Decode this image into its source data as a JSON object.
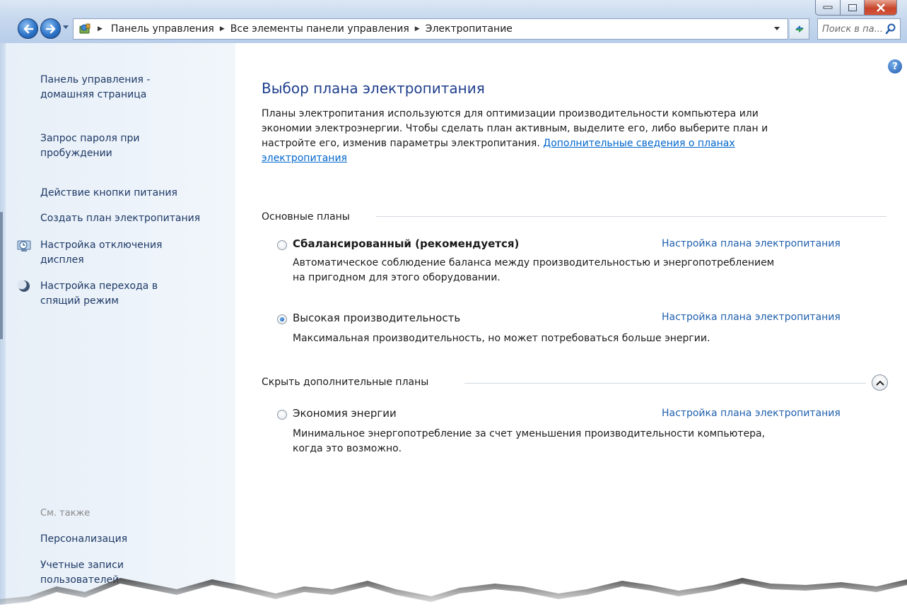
{
  "address": {
    "crumbs": [
      "Панель управления",
      "Все элементы панели управления",
      "Электропитание"
    ],
    "search_placeholder": "Поиск в па..."
  },
  "sidebar": {
    "home_line1": "Панель управления -",
    "home_line2": "домашняя страница",
    "items": [
      {
        "line1": "Запрос пароля при",
        "line2": "пробуждении"
      },
      {
        "line1": "Действие кнопки питания"
      },
      {
        "line1": "Создать план электропитания"
      },
      {
        "line1": "Настройка отключения",
        "line2": "дисплея",
        "icon": "display-clock-icon"
      },
      {
        "line1": "Настройка перехода в",
        "line2": "спящий режим",
        "icon": "sleep-moon-icon"
      }
    ],
    "see_also_label": "См. также",
    "see_also": [
      {
        "line1": "Персонализация"
      },
      {
        "line1": "Учетные записи",
        "line2": "пользователей"
      }
    ]
  },
  "main": {
    "title": "Выбор плана электропитания",
    "desc_line1": "Планы электропитания используются для оптимизации производительности компьютера или",
    "desc_line2": "экономии электроэнергии. Чтобы сделать план активным, выделите его, либо выберите план и",
    "desc_line3": "настройте его, изменив параметры электропитания.",
    "desc_link_part1": "Дополнительные сведения о планах",
    "desc_link_part2": "электропитания",
    "section_basic": "Основные планы",
    "section_hide": "Скрыть дополнительные планы",
    "plans": [
      {
        "name": "Сбалансированный (рекомендуется)",
        "selected": false,
        "link": "Настройка плана электропитания",
        "desc_line1": "Автоматическое соблюдение баланса между производительностью и энергопотреблением",
        "desc_line2": "на пригодном для этого оборудовании."
      },
      {
        "name": "Высокая производительность",
        "selected": true,
        "link": "Настройка плана электропитания",
        "desc_line1": "Максимальная производительность, но может потребоваться больше энергии."
      },
      {
        "name": "Экономия энергии",
        "selected": false,
        "link": "Настройка плана электропитания",
        "desc_line1": "Минимальное энергопотребление за счет уменьшения производительности компьютера,",
        "desc_line2": "когда это возможно."
      }
    ]
  },
  "colors": {
    "link": "#1f5fad",
    "title": "#1e3e8c",
    "sidebar_link": "#1e3966"
  }
}
